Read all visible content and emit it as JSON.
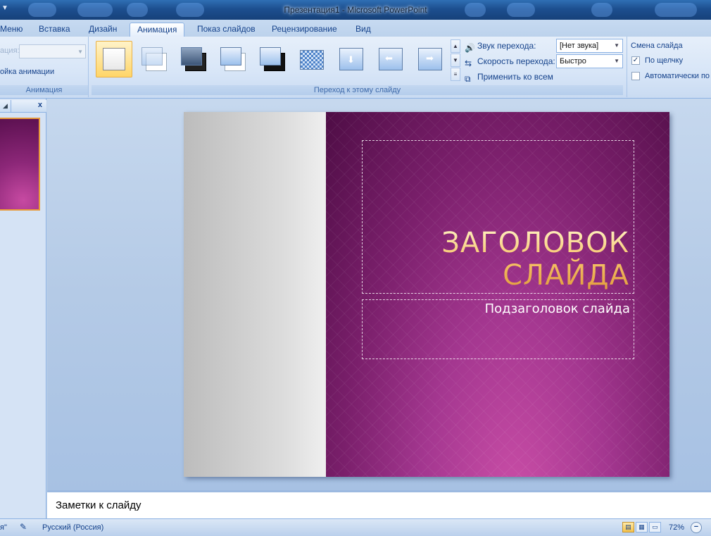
{
  "window": {
    "title": "Презентация1 - Microsoft PowerPoint"
  },
  "tabs": [
    "Меню",
    "Вставка",
    "Дизайн",
    "Анимация",
    "Показ слайдов",
    "Рецензирование",
    "Вид"
  ],
  "active_tab": "Анимация",
  "ribbon": {
    "animation_group": {
      "animate_label": "ация:",
      "custom_animation": "ойка анимации",
      "label": "Анимация"
    },
    "transition_group": {
      "label": "Переход к этому слайду",
      "sound_label": "Звук перехода:",
      "sound_value": "[Нет звука]",
      "speed_label": "Скорость перехода:",
      "speed_value": "Быстро",
      "apply_all_label": "Применить ко всем"
    },
    "advance_group": {
      "title": "Смена слайда",
      "on_click_label": "По щелчку",
      "on_click_checked": true,
      "auto_label": "Автоматически по",
      "auto_checked": false
    }
  },
  "slide_pane": {
    "close_label": "x"
  },
  "slide": {
    "title": "Заголовок слайда",
    "subtitle": "Подзаголовок слайда"
  },
  "notes": {
    "placeholder": "Заметки к слайду"
  },
  "status": {
    "left_fragment": "я\"",
    "language": "Русский (Россия)",
    "zoom": "72%"
  },
  "colors": {
    "slide_accent": "#7a1f6b",
    "title_gold": "#f7c46a",
    "ribbon_text": "#15428b"
  }
}
